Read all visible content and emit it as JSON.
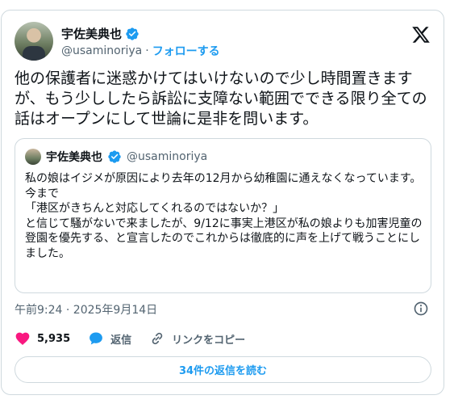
{
  "author": {
    "display_name": "宇佐美典也",
    "handle": "@usaminoriya",
    "separator": "·",
    "follow_label": "フォローする"
  },
  "tweet": {
    "text": "他の保護者に迷惑かけてはいけないので少し時間置きますが、もう少ししたら訴訟に支障ない範囲でできる限り全ての話はオープンにして世論に是非を問います。"
  },
  "quote": {
    "display_name": "宇佐美典也",
    "handle": "@usaminoriya",
    "text": "私の娘はイジメが原因により去年の12月から幼稚園に通えなくなっています。\n今まで\n「港区がきちんと対応してくれるのではないか？」\nと信じて騒がないで来ましたが、9/12に事実上港区が私の娘よりも加害児童の登園を優先する、と宣言したのでこれからは徹底的に声を上げて戦うことにしました。"
  },
  "meta": {
    "timestamp": "午前9:24 · 2025年9月14日"
  },
  "actions": {
    "likes": "5,935",
    "reply_label": "返信",
    "copy_link_label": "リンクをコピー"
  },
  "replies_button": "34件の返信を読む",
  "colors": {
    "accent": "#1d9bf0",
    "like": "#f91880",
    "text": "#0f1419",
    "muted": "#536471",
    "border": "#cfd9de"
  }
}
